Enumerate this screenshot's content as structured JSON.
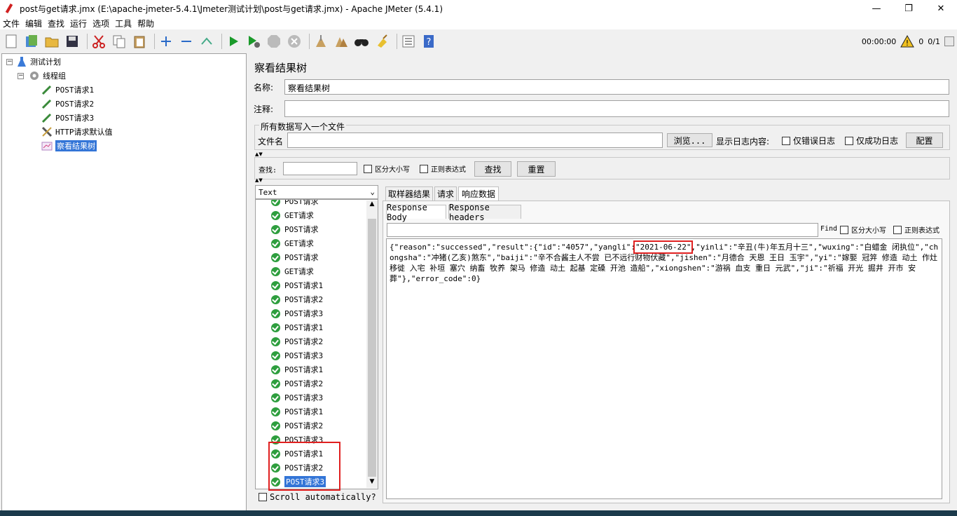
{
  "window": {
    "title": "post与get请求.jmx (E:\\apache-jmeter-5.4.1\\Jmeter测试计划\\post与get请求.jmx) - Apache JMeter (5.4.1)",
    "min": "—",
    "max": "❐",
    "close": "✕"
  },
  "menu": [
    "文件",
    "编辑",
    "查找",
    "运行",
    "选项",
    "工具",
    "帮助"
  ],
  "toolbar_status": {
    "timer": "00:00:00",
    "warnings": "0",
    "threads": "0/1"
  },
  "tree": [
    {
      "label": "测试计划",
      "icon": "flask-icon"
    },
    {
      "label": "线程组",
      "icon": "gear-icon"
    },
    {
      "label": "POST请求1",
      "icon": "pipette-icon"
    },
    {
      "label": "POST请求2",
      "icon": "pipette-icon"
    },
    {
      "label": "POST请求3",
      "icon": "pipette-icon"
    },
    {
      "label": "HTTP请求默认值",
      "icon": "wrench-icon"
    },
    {
      "label": "察看结果树",
      "icon": "chart-icon"
    }
  ],
  "panel": {
    "heading": "察看结果树",
    "name_label": "名称:",
    "name_value": "察看结果树",
    "comment_label": "注释:",
    "comment_value": "",
    "file_group": "所有数据写入一个文件",
    "filename_label": "文件名",
    "filename_value": "",
    "browse": "浏览...",
    "log_label": "显示日志内容:",
    "errors_only": "仅错误日志",
    "success_only": "仅成功日志",
    "configure": "配置"
  },
  "search": {
    "label": "查找:",
    "value": "",
    "case_sensitive": "区分大小写",
    "regex": "正则表达式",
    "find_button": "查找",
    "reset_button": "重置"
  },
  "renderer": {
    "selected": "Text"
  },
  "samples": [
    "POST请求",
    "GET请求",
    "POST请求",
    "GET请求",
    "POST请求",
    "GET请求",
    "POST请求1",
    "POST请求2",
    "POST请求3",
    "POST请求1",
    "POST请求2",
    "POST请求3",
    "POST请求1",
    "POST请求2",
    "POST请求3",
    "POST请求1",
    "POST请求2",
    "POST请求3",
    "POST请求1",
    "POST请求2",
    "POST请求3"
  ],
  "scroll_auto": "Scroll automatically?",
  "tabs": [
    "取样器结果",
    "请求",
    "响应数据"
  ],
  "subtabs": [
    "Response Body",
    "Response headers"
  ],
  "find_bar": {
    "label": "Find",
    "case_sensitive": "区分大小写",
    "regex": "正则表达式"
  },
  "response": {
    "part1": "{\"reason\":\"successed\",\"result\":{\"id\":\"4057\",\"yangli\":",
    "date": "\"2021-06-22\"",
    "part2": ",\"yinli\":\"辛丑(牛)年五月十三\",\"wuxing\":\"白蜡金 闭执位\",\"chongsha\":\"冲猪(乙亥)煞东\",\"baiji\":\"辛不合酱主人不尝 已不远行财物伏藏\",\"jishen\":\"月德合 天恩 王日 玉宇\",\"yi\":\"嫁娶 冠笄 修造 动土 作灶 移徙 入宅 补垣 塞穴 纳畜 牧养 架马 修造 动土 起基 定磉 开池 造船\",\"xiongshen\":\"游祸 血支 重日 元武\",\"ji\":\"祈福 开光 掘井 开市 安葬\"},\"error_code\":0}"
  },
  "colors": {
    "accent": "#3375d7",
    "highlight": "#e02020",
    "ok": "#2e9e3e"
  }
}
